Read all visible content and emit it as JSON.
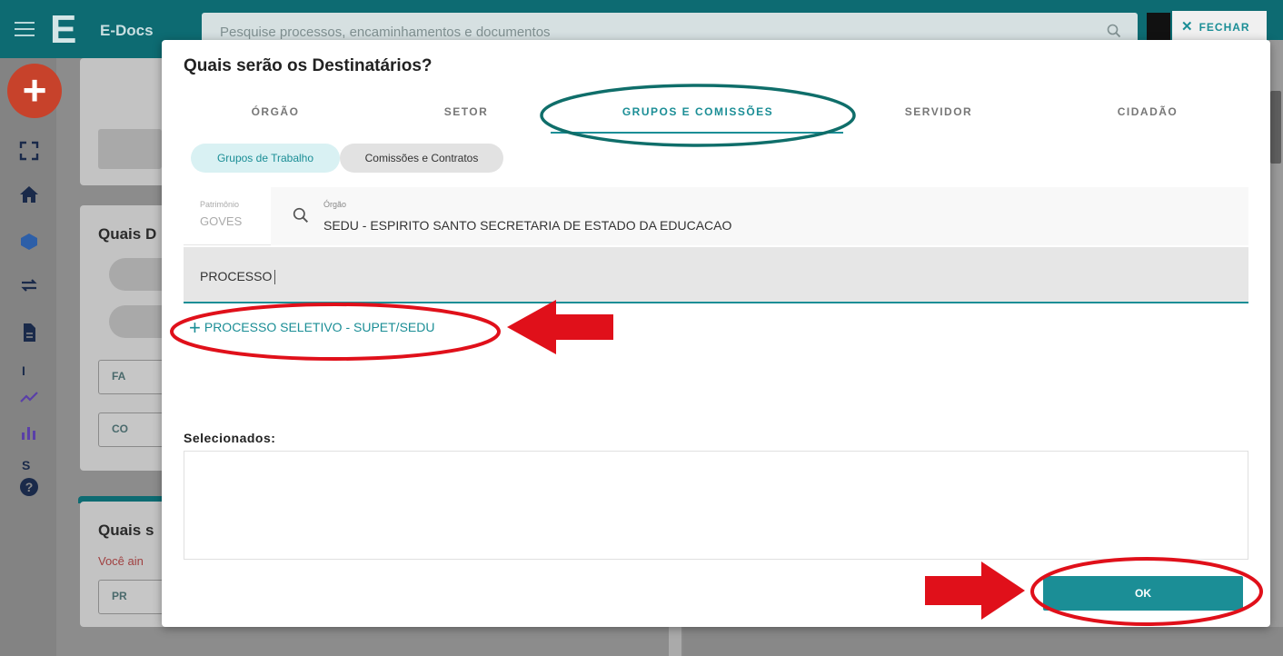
{
  "app": {
    "name": "E-Docs",
    "logo_letter": "E",
    "logo_small": "DOCS",
    "search_placeholder": "Pesquise processos, encaminhamentos e documentos",
    "close_label": "FECHAR"
  },
  "sidebar": {
    "add_label": "+",
    "rail_letters": [
      "I",
      "S"
    ]
  },
  "background": {
    "section1_title": "Quais D",
    "section2_title": "Quais s",
    "section2_subtitle": "Você ain",
    "btn_upload": "FA",
    "btn_copy": "CO",
    "btn_search": "PR"
  },
  "modal": {
    "title": "Quais serão os Destinatários?",
    "tabs": [
      {
        "label": "ÓRGÃO",
        "active": false
      },
      {
        "label": "SETOR",
        "active": false
      },
      {
        "label": "GRUPOS E COMISSÕES",
        "active": true
      },
      {
        "label": "SERVIDOR",
        "active": false
      },
      {
        "label": "CIDADÃO",
        "active": false
      }
    ],
    "chips": [
      {
        "label": "Grupos de Trabalho",
        "active": true
      },
      {
        "label": "Comissões e Contratos",
        "active": false
      }
    ],
    "patrimonio": {
      "label": "Patrimônio",
      "value": "GOVES"
    },
    "orgao": {
      "label": "Órgão",
      "value": "SEDU - ESPIRITO SANTO SECRETARIA DE ESTADO DA EDUCACAO"
    },
    "search_value": "PROCESSO",
    "result": "PROCESSO SELETIVO - SUPET/SEDU",
    "selected_label": "Selecionados:",
    "ok_label": "OK"
  },
  "colors": {
    "teal": "#1b8e96",
    "annotation_red": "#e0101a",
    "annotation_teal": "#0f6e6a"
  }
}
